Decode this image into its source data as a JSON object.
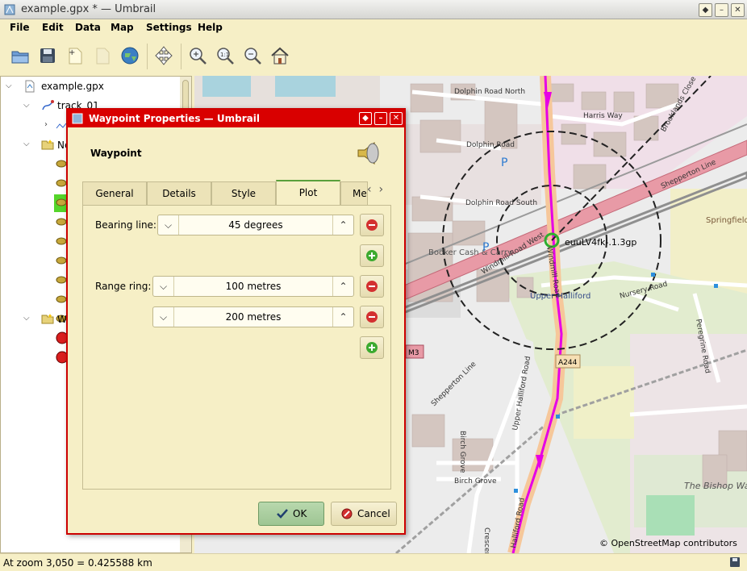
{
  "window": {
    "title": "example.gpx * — Umbrail"
  },
  "menu": [
    "File",
    "Edit",
    "Data",
    "Map",
    "Settings",
    "Help"
  ],
  "toolbar": {
    "icons": [
      "open-icon",
      "save-icon",
      "new-waypoint-icon",
      "new-note-icon",
      "web-map-icon",
      "move-icon",
      "zoom-in-icon",
      "zoom-actual-icon",
      "zoom-out-icon",
      "home-icon"
    ]
  },
  "tree": {
    "root": "example.gpx",
    "track": "track_01",
    "folder1": "Ne",
    "folder2": "W"
  },
  "map": {
    "attribution": "© OpenStreetMap contributors",
    "waypoint_label": "euuLV4fk-.1.3gp",
    "labels": {
      "dolphin_road_north": "Dolphin Road North",
      "harris_way": "Harris Way",
      "brooklands_close": "Brooklands Close",
      "dolphin_road": "Dolphin Road",
      "shepperton_line": "Shepperton Line",
      "dolphin_road_south": "Dolphin Road South",
      "windmill_road_west": "Windmill Road West",
      "windmill_road": "Windmill Road",
      "springfield_school": "Springfield Primary School",
      "booker": "Booker Cash & Carry",
      "nursery_road": "Nursery Road",
      "upper_halliford": "Upper Halliford",
      "peregrine_road": "Peregrine Road",
      "m3": "M3",
      "a244": "A244",
      "shepperton_line2": "Shepperton Line",
      "birch_grove": "Birch Grove",
      "upper_halliford_road": "Upper Halliford Road",
      "halliford_road": "Halliford Road",
      "crescent_drive": "Crescent Drive",
      "bishop_school": "The Bishop Wand Church of England School",
      "parking": "P"
    }
  },
  "status": {
    "text": "At zoom 3,050 = 0.425588 km"
  },
  "dialog": {
    "title": "Waypoint Properties — Umbrail",
    "heading": "Waypoint",
    "tabs": [
      "General",
      "Details",
      "Style",
      "Plot",
      "Met"
    ],
    "active_tab": "Plot",
    "bearing_label": "Bearing line:",
    "bearing_value": "45 degrees",
    "range_label": "Range ring:",
    "range_values": [
      "100 metres",
      "200 metres"
    ],
    "ok_label": "OK",
    "cancel_label": "Cancel"
  },
  "colors": {
    "accent_red": "#d90000",
    "route_magenta": "#e600e6",
    "ok_green": "#9ec593",
    "window_bg": "#f6efc6"
  }
}
